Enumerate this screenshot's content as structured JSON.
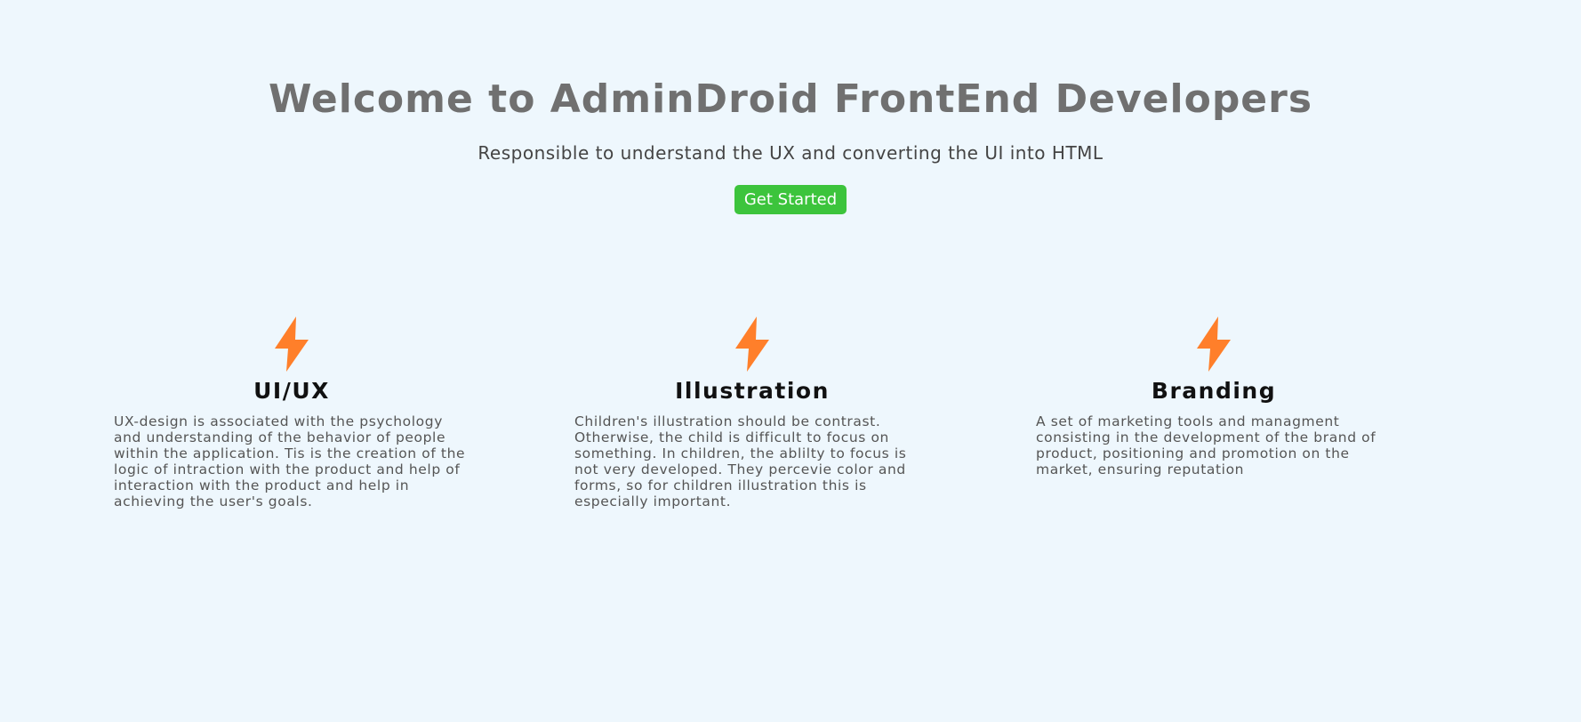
{
  "hero": {
    "title": "Welcome to AdminDroid FrontEnd Developers",
    "subtitle": "Responsible to understand the UX and converting the UI into HTML",
    "cta_label": "Get Started"
  },
  "features": [
    {
      "icon": "lightning-bolt-icon",
      "title": "UI/UX",
      "description": "UX-design is associated with the psychology and understanding of the behavior of people within the application. Tis is the creation of the logic of intraction with the product and help of interaction with the product and help in achieving the user's goals."
    },
    {
      "icon": "lightning-bolt-icon",
      "title": "Illustration",
      "description": "Children's illustration should be contrast. Otherwise, the child is difficult to focus on something. In children, the ablilty to focus is not very developed. They percevie color and forms, so for children illustration this is especially important."
    },
    {
      "icon": "lightning-bolt-icon",
      "title": "Branding",
      "description": "A set of marketing tools and managment consisting in the development of the brand of product, positioning and promotion on the market, ensuring reputation"
    }
  ],
  "colors": {
    "background": "#eef7fd",
    "title": "#707070",
    "accent_button": "#3cc43c",
    "icon": "#ff7f2a"
  }
}
